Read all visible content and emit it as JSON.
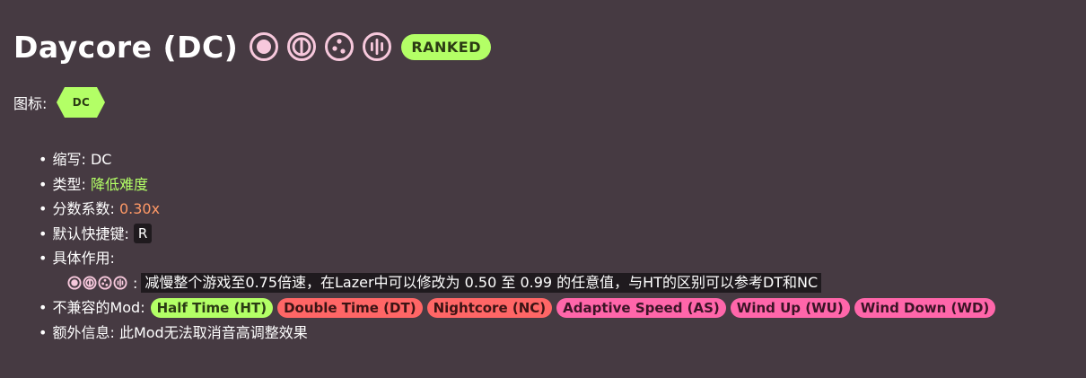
{
  "header": {
    "title": "Daycore (DC)",
    "rulesets": [
      "osu-standard-icon",
      "taiko-icon",
      "catch-icon",
      "mania-icon"
    ],
    "status_badge": "RANKED"
  },
  "icon_section": {
    "label": "图标:",
    "mod_acronym": "DC"
  },
  "info": {
    "acronym_label": "缩写:",
    "acronym_value": "DC",
    "type_label": "类型:",
    "type_value": "降低难度",
    "multiplier_label": "分数系数:",
    "multiplier_value": "0.30x",
    "hotkey_label": "默认快捷键:",
    "hotkey_value": "R",
    "effect_label": "具体作用:",
    "effect_separator": ":",
    "effect_text": "减慢整个游戏至0.75倍速，在Lazer中可以修改为 0.50 至 0.99 的任意值，与HT的区别可以参考DT和NC",
    "incompatible_label": "不兼容的Mod:",
    "incompatible_mods": [
      {
        "label": "Half Time (HT)",
        "color": "#b3ff66"
      },
      {
        "label": "Double Time (DT)",
        "color": "#ff6666"
      },
      {
        "label": "Nightcore (NC)",
        "color": "#ff6666"
      },
      {
        "label": "Adaptive Speed (AS)",
        "color": "#ff66aa"
      },
      {
        "label": "Wind Up (WU)",
        "color": "#ff66aa"
      },
      {
        "label": "Wind Down (WD)",
        "color": "#ff66aa"
      }
    ],
    "extra_label": "额外信息:",
    "extra_value": "此Mod无法取消音高调整效果"
  },
  "colors": {
    "background": "#463a42",
    "ruleset_icon": "#f7c8dc",
    "difficulty_reduction": "#b3ff66",
    "multiplier": "#ff9966"
  }
}
